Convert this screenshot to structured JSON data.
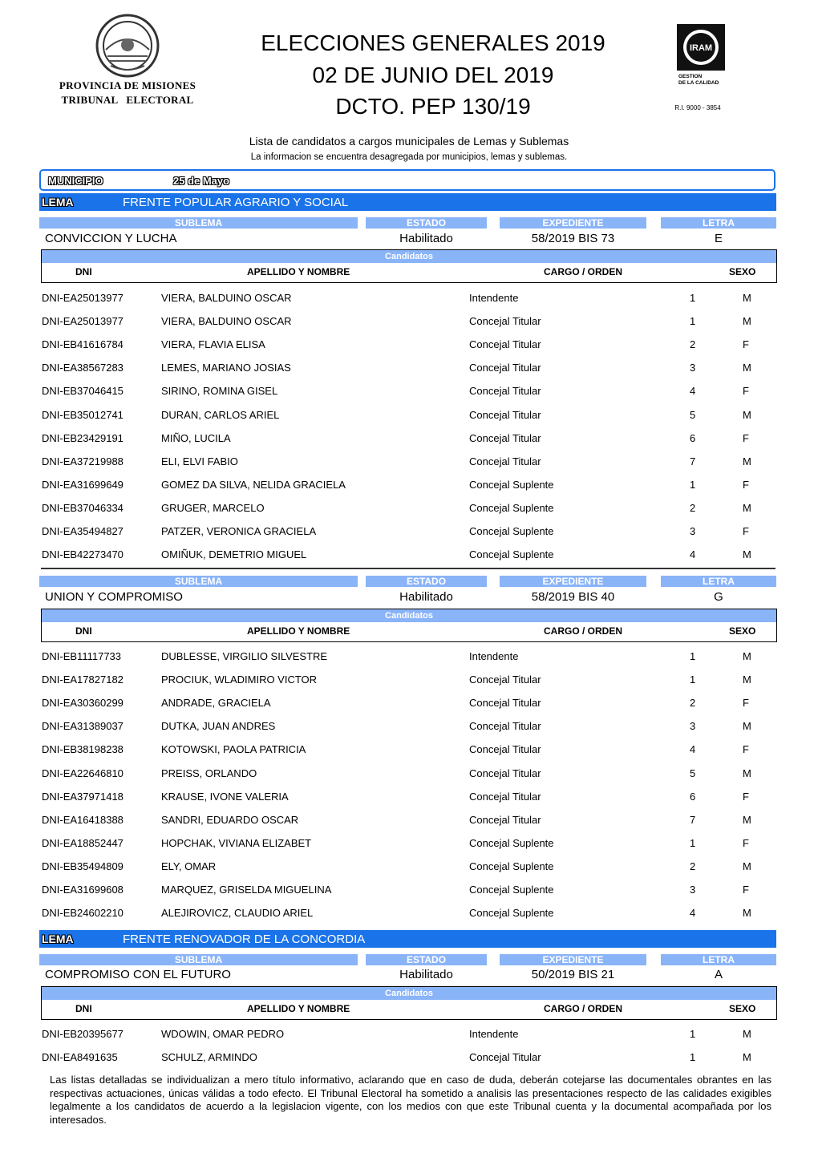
{
  "header": {
    "province_line_1": "PROVINCIA DE MISIONES",
    "province_line_2": "TRIBUNAL   ELECTORAL",
    "title_1": "ELECCIONES GENERALES 2019",
    "title_2": "02 DE JUNIO DEL 2019",
    "title_3": "DCTO. PEP 130/19",
    "iram_logo_text": "IRAM",
    "iram_caption_1": "GESTION",
    "iram_caption_2": "DE LA CALIDAD",
    "iram_ri": "R.I. 9000 - 3854",
    "intro_1": "Lista de candidatos a cargos municipales de Lemas y Sublemas",
    "intro_2": "La informacion se encuentra desagregada por municipios, lemas y sublemas."
  },
  "municipio": {
    "label": "MUNICIPIO",
    "value": "25 de Mayo"
  },
  "labels": {
    "lema": "LEMA",
    "sublema": "SUBLEMA",
    "estado": "ESTADO",
    "expediente": "EXPEDIENTE",
    "letra": "LETRA",
    "candidatos": "Candidatos",
    "dni": "DNI",
    "apellido": "APELLIDO Y NOMBRE",
    "cargo": "CARGO / ORDEN",
    "sexo": "SEXO"
  },
  "lemas": [
    {
      "name": "FRENTE POPULAR AGRARIO Y SOCIAL"
    },
    {
      "name": "FRENTE RENOVADOR DE LA CONCORDIA"
    }
  ],
  "sublemas": [
    {
      "name": "CONVICCION Y LUCHA",
      "estado": "Habilitado",
      "expediente": "58/2019 BIS 73",
      "letra": "E",
      "candidates": [
        {
          "dni": "DNI-EA25013977",
          "name": "VIERA, BALDUINO OSCAR",
          "cargo": "Intendente",
          "orden": "1",
          "sexo": "M"
        },
        {
          "dni": "DNI-EA25013977",
          "name": "VIERA, BALDUINO OSCAR",
          "cargo": "Concejal Titular",
          "orden": "1",
          "sexo": "M"
        },
        {
          "dni": "DNI-EB41616784",
          "name": "VIERA, FLAVIA ELISA",
          "cargo": "Concejal Titular",
          "orden": "2",
          "sexo": "F"
        },
        {
          "dni": "DNI-EA38567283",
          "name": "LEMES, MARIANO JOSIAS",
          "cargo": "Concejal Titular",
          "orden": "3",
          "sexo": "M"
        },
        {
          "dni": "DNI-EB37046415",
          "name": "SIRINO, ROMINA GISEL",
          "cargo": "Concejal Titular",
          "orden": "4",
          "sexo": "F"
        },
        {
          "dni": "DNI-EB35012741",
          "name": "DURAN, CARLOS ARIEL",
          "cargo": "Concejal Titular",
          "orden": "5",
          "sexo": "M"
        },
        {
          "dni": "DNI-EB23429191",
          "name": "MIÑO, LUCILA",
          "cargo": "Concejal Titular",
          "orden": "6",
          "sexo": "F"
        },
        {
          "dni": "DNI-EA37219988",
          "name": "ELI, ELVI FABIO",
          "cargo": "Concejal Titular",
          "orden": "7",
          "sexo": "M"
        },
        {
          "dni": "DNI-EA31699649",
          "name": "GOMEZ DA SILVA, NELIDA GRACIELA",
          "cargo": "Concejal Suplente",
          "orden": "1",
          "sexo": "F"
        },
        {
          "dni": "DNI-EB37046334",
          "name": "GRUGER, MARCELO",
          "cargo": "Concejal Suplente",
          "orden": "2",
          "sexo": "M"
        },
        {
          "dni": "DNI-EA35494827",
          "name": "PATZER, VERONICA GRACIELA",
          "cargo": "Concejal Suplente",
          "orden": "3",
          "sexo": "F"
        },
        {
          "dni": "DNI-EB42273470",
          "name": "OMIÑUK, DEMETRIO MIGUEL",
          "cargo": "Concejal Suplente",
          "orden": "4",
          "sexo": "M"
        }
      ]
    },
    {
      "name": "UNION Y COMPROMISO",
      "estado": "Habilitado",
      "expediente": "58/2019 BIS 40",
      "letra": "G",
      "candidates": [
        {
          "dni": "DNI-EB11117733",
          "name": "DUBLESSE, VIRGILIO SILVESTRE",
          "cargo": "Intendente",
          "orden": "1",
          "sexo": "M"
        },
        {
          "dni": "DNI-EA17827182",
          "name": "PROCIUK, WLADIMIRO VICTOR",
          "cargo": "Concejal Titular",
          "orden": "1",
          "sexo": "M"
        },
        {
          "dni": "DNI-EA30360299",
          "name": "ANDRADE, GRACIELA",
          "cargo": "Concejal Titular",
          "orden": "2",
          "sexo": "F"
        },
        {
          "dni": "DNI-EA31389037",
          "name": "DUTKA, JUAN ANDRES",
          "cargo": "Concejal Titular",
          "orden": "3",
          "sexo": "M"
        },
        {
          "dni": "DNI-EB38198238",
          "name": "KOTOWSKI, PAOLA PATRICIA",
          "cargo": "Concejal Titular",
          "orden": "4",
          "sexo": "F"
        },
        {
          "dni": "DNI-EA22646810",
          "name": "PREISS, ORLANDO",
          "cargo": "Concejal Titular",
          "orden": "5",
          "sexo": "M"
        },
        {
          "dni": "DNI-EA37971418",
          "name": "KRAUSE, IVONE VALERIA",
          "cargo": "Concejal Titular",
          "orden": "6",
          "sexo": "F"
        },
        {
          "dni": "DNI-EA16418388",
          "name": "SANDRI, EDUARDO OSCAR",
          "cargo": "Concejal Titular",
          "orden": "7",
          "sexo": "M"
        },
        {
          "dni": "DNI-EA18852447",
          "name": "HOPCHAK, VIVIANA ELIZABET",
          "cargo": "Concejal Suplente",
          "orden": "1",
          "sexo": "F"
        },
        {
          "dni": "DNI-EB35494809",
          "name": "ELY, OMAR",
          "cargo": "Concejal Suplente",
          "orden": "2",
          "sexo": "M"
        },
        {
          "dni": "DNI-EA31699608",
          "name": "MARQUEZ, GRISELDA MIGUELINA",
          "cargo": "Concejal Suplente",
          "orden": "3",
          "sexo": "F"
        },
        {
          "dni": "DNI-EB24602210",
          "name": "ALEJIROVICZ, CLAUDIO ARIEL",
          "cargo": "Concejal Suplente",
          "orden": "4",
          "sexo": "M"
        }
      ]
    },
    {
      "name": "COMPROMISO CON EL FUTURO",
      "estado": "Habilitado",
      "expediente": "50/2019 BIS 21",
      "letra": "A",
      "candidates": [
        {
          "dni": "DNI-EB20395677",
          "name": "WDOWIN, OMAR PEDRO",
          "cargo": "Intendente",
          "orden": "1",
          "sexo": "M"
        },
        {
          "dni": "DNI-EA8491635",
          "name": "SCHULZ, ARMINDO",
          "cargo": "Concejal Titular",
          "orden": "1",
          "sexo": "M"
        }
      ]
    }
  ],
  "footer": "Las listas detalladas se individualizan a mero título informativo, aclarando que en caso de duda, deberán cotejarse las documentales obrantes en las respectivas actuaciones, únicas válidas a todo efecto. El Tribunal Electoral ha sometido a analisis las presentaciones respecto de las calidades exigibles legalmente a los candidatos de acuerdo a la legislacion vigente, con los medios con que este Tribunal cuenta y la documental acompañada por los interesados.",
  "colors": {
    "lema_bar": "#1a73e8",
    "pill": "#8ab4f8"
  }
}
